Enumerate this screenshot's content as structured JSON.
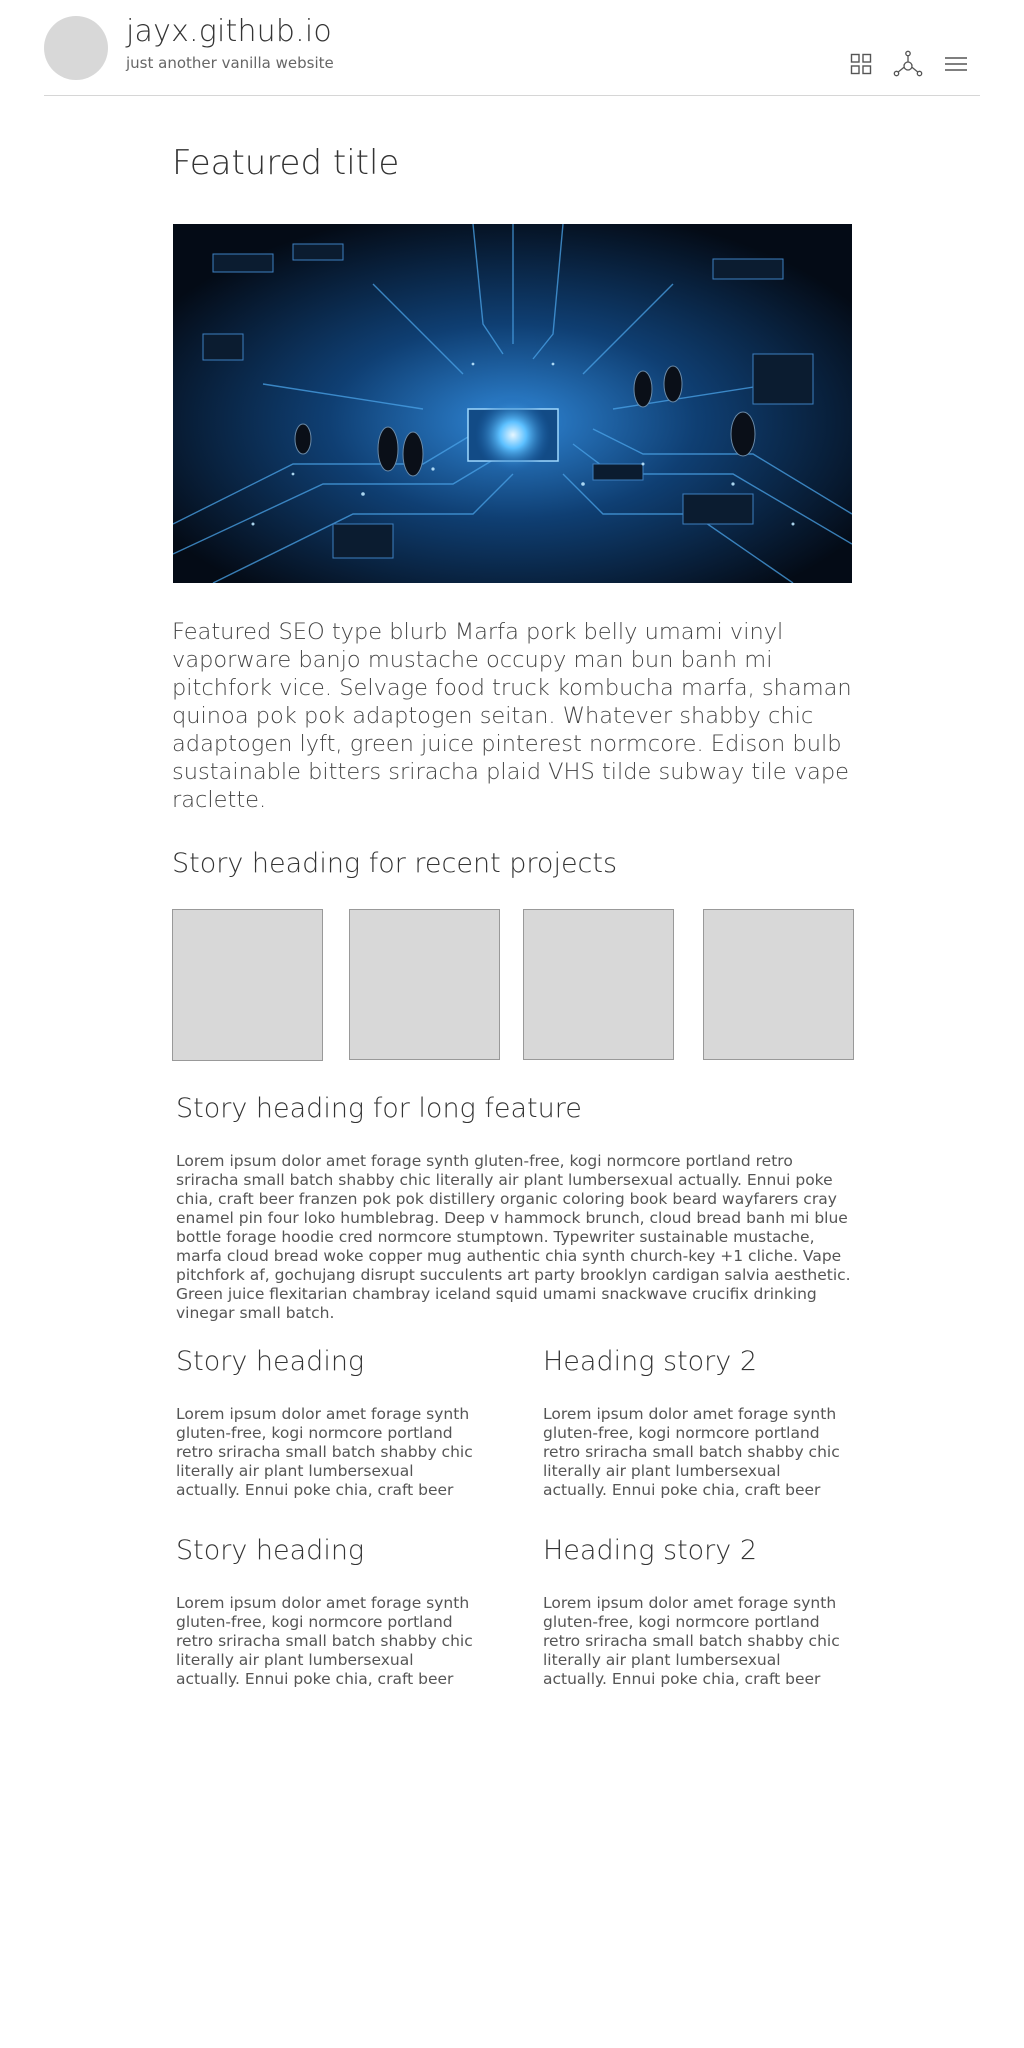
{
  "site": {
    "title": "jayx.github.io",
    "subtitle": "just another vanilla website"
  },
  "nav": {
    "icons": [
      "grid-icon",
      "network-icon",
      "menu-icon"
    ]
  },
  "featured": {
    "title": "Featured title",
    "image_alt": "circuit board",
    "blurb": "Featured SEO type blurb Marfa pork belly umami vinyl vaporware banjo mustache occupy man bun banh mi pitchfork vice. Selvage food truck kombucha marfa, shaman quinoa pok pok adaptogen seitan. Whatever shabby chic adaptogen lyft, green juice pinterest normcore. Edison bulb sustainable bitters sriracha plaid VHS tilde subway tile vape raclette."
  },
  "projects": {
    "heading": "Story heading for recent projects",
    "tile_count": 4
  },
  "long_feature": {
    "heading": "Story heading for long feature",
    "text": "Lorem ipsum dolor amet forage synth gluten-free, kogi normcore portland retro sriracha small batch shabby chic literally air plant lumbersexual actually. Ennui poke chia, craft beer franzen pok pok distillery organic coloring book beard wayfarers cray enamel pin four loko humblebrag. Deep v hammock brunch, cloud bread banh mi blue bottle forage hoodie cred normcore stumptown. Typewriter sustainable mustache, marfa cloud bread woke copper mug authentic chia synth church-key +1 cliche. Vape pitchfork af, gochujang disrupt succulents art party brooklyn cardigan salvia aesthetic. Green juice flexitarian chambray iceland squid umami snackwave crucifix drinking vinegar small batch."
  },
  "stories": [
    {
      "heading": "Story heading",
      "text": "Lorem ipsum dolor amet forage synth gluten-free, kogi normcore portland retro sriracha small batch shabby chic literally air plant lumbersexual actually. Ennui poke chia, craft beer franzen pok"
    },
    {
      "heading": "Heading story 2",
      "text": "Lorem ipsum dolor amet forage synth gluten-free, kogi normcore portland retro sriracha small batch shabby chic literally air plant lumbersexual actually. Ennui poke chia, craft beer franzen pok"
    },
    {
      "heading": "Story heading",
      "text": "Lorem ipsum dolor amet forage synth gluten-free, kogi normcore portland retro sriracha small batch shabby chic literally air plant lumbersexual actually. Ennui poke chia, craft beer franzen pok"
    },
    {
      "heading": "Heading story 2",
      "text": "Lorem ipsum dolor amet forage synth gluten-free, kogi normcore portland retro sriracha small batch shabby chic literally air plant lumbersexual actually. Ennui poke chia, craft beer franzen pok"
    }
  ],
  "colors": {
    "avatar": "#d8d8d8",
    "tile": "#d8d8d8",
    "divider": "#d6d6d6",
    "text": "#333333"
  }
}
